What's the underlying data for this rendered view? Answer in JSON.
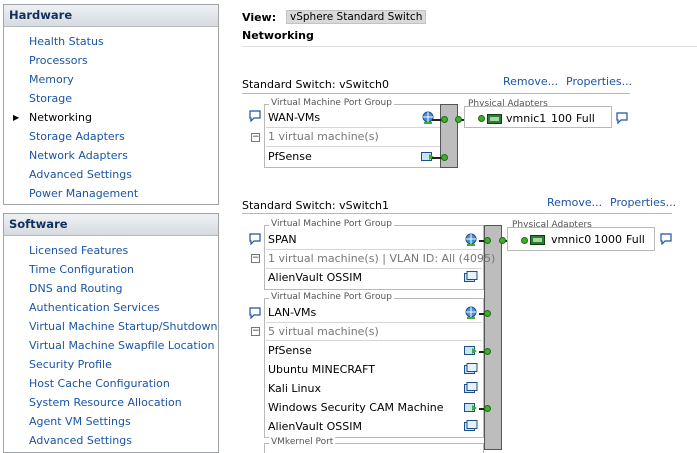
{
  "hardware": {
    "header": "Hardware",
    "items": [
      "Health Status",
      "Processors",
      "Memory",
      "Storage",
      "Networking",
      "Storage Adapters",
      "Network Adapters",
      "Advanced Settings",
      "Power Management"
    ],
    "selected": "Networking"
  },
  "software": {
    "header": "Software",
    "items": [
      "Licensed Features",
      "Time Configuration",
      "DNS and Routing",
      "Authentication Services",
      "Virtual Machine Startup/Shutdown",
      "Virtual Machine Swapfile Location",
      "Security Profile",
      "Host Cache Configuration",
      "System Resource Allocation",
      "Agent VM Settings",
      "Advanced Settings"
    ]
  },
  "main": {
    "view_label": "View:",
    "view_value": "vSphere Standard Switch",
    "heading": "Networking"
  },
  "switches": [
    {
      "title": "Standard Switch: vSwitch0",
      "remove": "Remove...",
      "properties": "Properties...",
      "groups": [
        {
          "group_label": "Virtual Machine Port Group",
          "name": "WAN-VMs",
          "vm_count": "1 virtual machine(s)",
          "vms": [
            "PfSense"
          ]
        }
      ],
      "adapters_label": "Physical Adapters",
      "adapter": {
        "name": "vmnic1",
        "speed": "100",
        "duplex": "Full"
      }
    },
    {
      "title": "Standard Switch: vSwitch1",
      "remove": "Remove...",
      "properties": "Properties...",
      "groups": [
        {
          "group_label": "Virtual Machine Port Group",
          "name": "SPAN",
          "vm_count": "1 virtual machine(s) | VLAN ID: All (4095)",
          "vms": [
            "AlienVault OSSIM"
          ]
        },
        {
          "group_label": "Virtual Machine Port Group",
          "name": "LAN-VMs",
          "vm_count": "5 virtual machine(s)",
          "vms": [
            "PfSense",
            "Ubuntu MINECRAFT",
            "Kali Linux",
            "Windows Security CAM Machine",
            "AlienVault OSSIM"
          ]
        },
        {
          "group_label": "VMkernel Port"
        }
      ],
      "adapters_label": "Physical Adapters",
      "adapter": {
        "name": "vmnic0",
        "speed": "1000",
        "duplex": "Full"
      }
    }
  ],
  "colors": {
    "link": "#1a55a5",
    "header_text": "#10305e",
    "port_connected": "#3fae2a"
  }
}
